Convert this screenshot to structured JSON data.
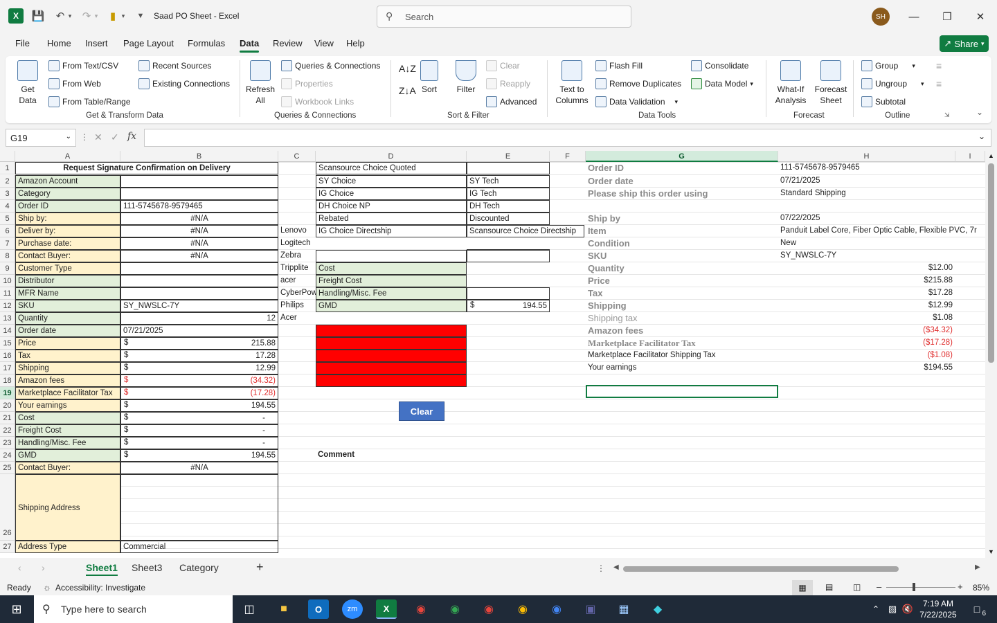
{
  "app": {
    "title": "Saad PO Sheet  -  Excel",
    "search_placeholder": "Search",
    "avatar_initials": "SH",
    "accent": "#107c41"
  },
  "menu": {
    "tabs": [
      "File",
      "Home",
      "Insert",
      "Page Layout",
      "Formulas",
      "Data",
      "Review",
      "View",
      "Help"
    ],
    "active": "Data",
    "share": "Share"
  },
  "ribbon": {
    "get_data": "Get Data",
    "from_text": "From Text/CSV",
    "from_web": "From Web",
    "from_table": "From Table/Range",
    "recent_sources": "Recent Sources",
    "existing_connections": "Existing Connections",
    "group1": "Get & Transform Data",
    "refresh": "Refresh All",
    "queries_connections": "Queries & Connections",
    "properties": "Properties",
    "workbook_links": "Workbook Links",
    "group2": "Queries & Connections",
    "sort": "Sort",
    "filter": "Filter",
    "clear": "Clear",
    "reapply": "Reapply",
    "advanced": "Advanced",
    "group3": "Sort & Filter",
    "text_to_columns": "Text to Columns",
    "flash_fill": "Flash Fill",
    "remove_duplicates": "Remove Duplicates",
    "data_validation": "Data Validation",
    "consolidate": "Consolidate",
    "data_model": "Data Model",
    "group4": "Data Tools",
    "what_if": "What-If Analysis",
    "forecast_sheet": "Forecast Sheet",
    "group5": "Forecast",
    "group_btn": "Group",
    "ungroup": "Ungroup",
    "subtotal": "Subtotal",
    "group6": "Outline"
  },
  "formula": {
    "name_box": "G19",
    "content": ""
  },
  "columns": [
    "A",
    "B",
    "C",
    "D",
    "E",
    "F",
    "G",
    "H",
    "I"
  ],
  "rows": [
    "1",
    "2",
    "3",
    "4",
    "5",
    "6",
    "7",
    "8",
    "9",
    "10",
    "11",
    "12",
    "13",
    "14",
    "15",
    "16",
    "17",
    "18",
    "19",
    "20",
    "21",
    "22",
    "23",
    "24",
    "25",
    "26",
    "27"
  ],
  "colA": [
    "Request Signature Confirmation on Delivery",
    "Amazon Account",
    "Category",
    "Order ID",
    "Ship by:",
    "Deliver by:",
    "Purchase date:",
    "Contact Buyer:",
    "Customer Type",
    "Distributor",
    "MFR Name",
    "SKU",
    "Quantity",
    "Order date",
    "Price",
    "Tax",
    "Shipping",
    "Amazon fees",
    "Marketplace Facilitator Tax",
    "Your earnings",
    "Cost",
    "Freight Cost",
    "Handling/Misc. Fee",
    "GMD",
    "Contact Buyer:",
    "Shipping Address",
    "Address Type"
  ],
  "colB": [
    "",
    "",
    "",
    "111-5745678-9579465",
    "#N/A",
    "#N/A",
    "#N/A",
    "#N/A",
    "",
    "",
    "",
    "SY_NWSLC-7Y",
    "12",
    "07/21/2025",
    "215.88",
    "17.28",
    "12.99",
    "(34.32)",
    "(17.28)",
    "194.55",
    "-",
    "-",
    "-",
    "194.55",
    "#N/A",
    "",
    "Commercial"
  ],
  "currency": "$",
  "colC": [
    "",
    "",
    "",
    "",
    "",
    "Lenovo",
    "Logitech",
    "Zebra",
    "Tripplite",
    "acer",
    "CyberPow",
    "Philips",
    "Acer"
  ],
  "colD": [
    "Scansource Choice Quoted",
    "SY Choice",
    "IG Choice",
    "DH Choice NP",
    "Rebated",
    "IG Choice Directship",
    "",
    "",
    "Cost",
    "Freight Cost",
    "Handling/Misc. Fee",
    "GMD"
  ],
  "colE": [
    "",
    "SY Tech",
    "IG Tech",
    "DH Tech",
    "Discounted",
    "Scansource Choice Directship",
    "",
    "",
    "",
    "",
    "",
    "194.55"
  ],
  "comment_label": "Comment",
  "clear_button": "Clear",
  "colG": [
    "Order ID",
    "Order date",
    "Please ship this order using",
    "",
    "Ship by",
    "Item",
    "Condition",
    "SKU",
    "Quantity",
    "Price",
    "Tax",
    "Shipping",
    "Shipping tax",
    "Amazon fees",
    "Marketplace Facilitator Tax",
    "Marketplace Facilitator Shipping Tax",
    "Your earnings"
  ],
  "colH": [
    "111-5745678-9579465",
    "07/21/2025",
    "Standard Shipping",
    "",
    "07/22/2025",
    "Panduit Label Core, Fiber Optic Cable, Flexible PVC, 7r",
    "New",
    "SY_NWSLC-7Y",
    "$12.00",
    "$215.88",
    "$17.28",
    "$12.99",
    "$1.08",
    "($34.32)",
    "($17.28)",
    "($1.08)",
    "$194.55"
  ],
  "sheets": [
    "Sheet1",
    "Sheet3",
    "Category"
  ],
  "active_sheet": "Sheet1",
  "status": {
    "ready": "Ready",
    "accessibility": "Accessibility: Investigate",
    "zoom": "85%"
  },
  "taskbar": {
    "search": "Type here to search",
    "time": "7:19 AM",
    "date": "7/22/2025",
    "notif": "6"
  }
}
